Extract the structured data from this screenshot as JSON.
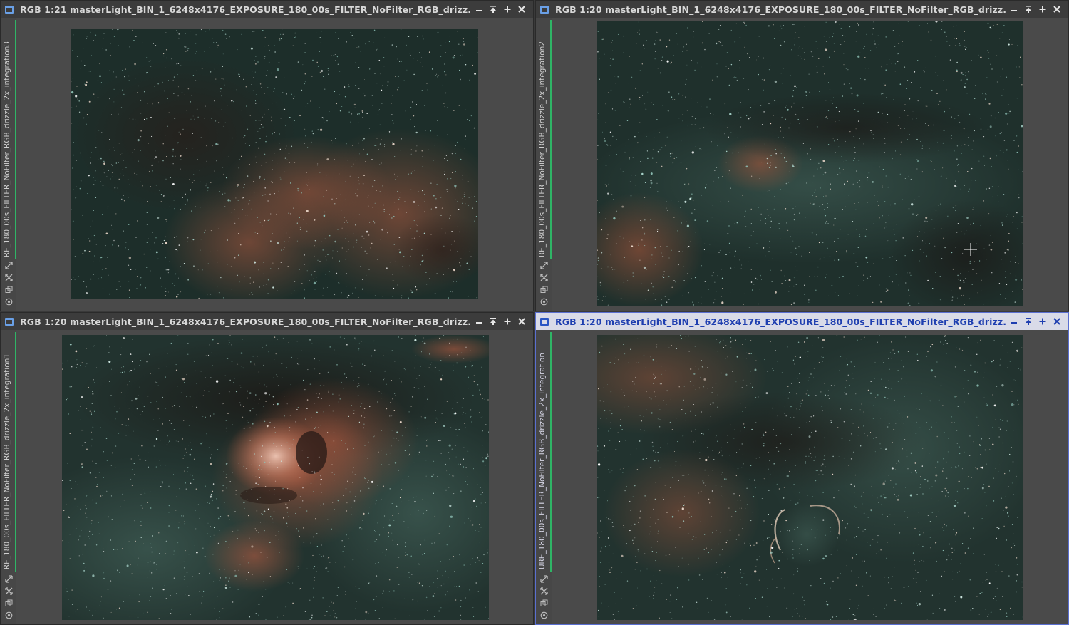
{
  "colors": {
    "accent_green": "#2fb566",
    "active_border": "#5a6fd0",
    "active_title": "#1f3fb0"
  },
  "windows": [
    {
      "title": "RGB 1:21 masterLight_BIN_1_6248x4176_EXPOSURE_180_00s_FILTER_NoFilter_RGB_drizz...",
      "view_id": "RE_180_00s_FILTER_NoFilter_RGB_drizzle_2x_integration3",
      "active": false
    },
    {
      "title": "RGB 1:20 masterLight_BIN_1_6248x4176_EXPOSURE_180_00s_FILTER_NoFilter_RGB_drizz...",
      "view_id": "RE_180_00s_FILTER_NoFilter_RGB_drizzle_2x_integration2",
      "active": false
    },
    {
      "title": "RGB 1:20 masterLight_BIN_1_6248x4176_EXPOSURE_180_00s_FILTER_NoFilter_RGB_drizz...",
      "view_id": "RE_180_00s_FILTER_NoFilter_RGB_drizzle_2x_integration1",
      "active": false
    },
    {
      "title": "RGB 1:20 masterLight_BIN_1_6248x4176_EXPOSURE_180_00s_FILTER_NoFilter_RGB_drizz...",
      "view_id": "URE_180_00s_FILTER_NoFilter_RGB_drizzle_2x_integration",
      "active": true
    }
  ],
  "icons": {
    "window": "window-icon",
    "minimize": "minimize-icon",
    "shade": "shade-icon",
    "maximize": "maximize-icon",
    "close": "close-icon",
    "sidebar_tools": [
      "fit-view-icon",
      "zoom-icon",
      "clone-icon",
      "view-options-icon"
    ]
  }
}
